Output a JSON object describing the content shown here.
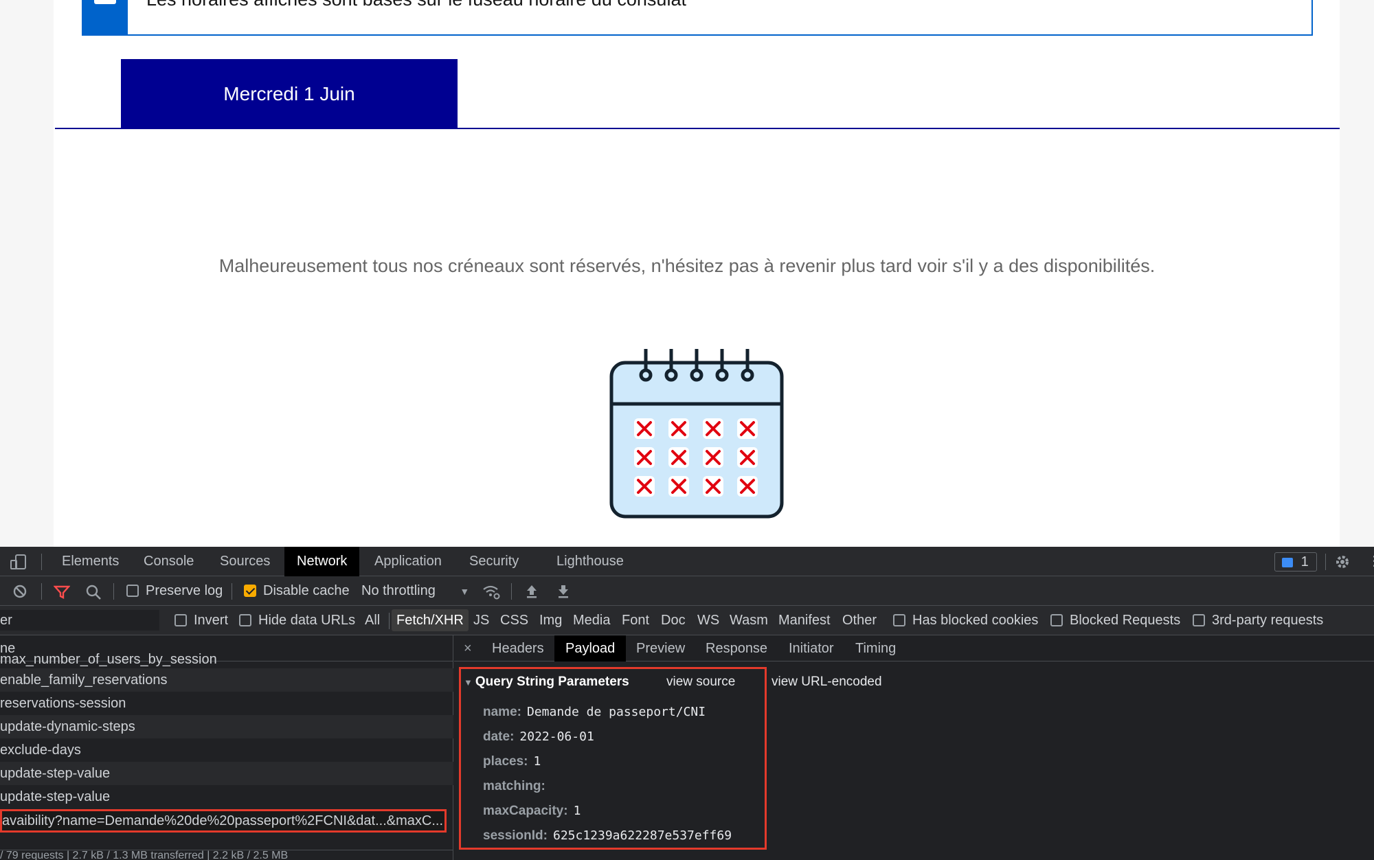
{
  "page": {
    "info_text": "Les horaires affichés sont basés sur le fuseau horaire du consulat",
    "day_tab": "Mercredi 1 Juin",
    "empty_message": "Malheureusement tous nos créneaux sont réservés, n'hésitez pas à revenir plus tard voir s'il y a des disponibilités."
  },
  "devtools": {
    "tabs": [
      "Elements",
      "Console",
      "Sources",
      "Network",
      "Application",
      "Security",
      "Lighthouse"
    ],
    "active_tab": "Network",
    "issues_count": "1",
    "toolbar": {
      "preserve_log": "Preserve log",
      "disable_cache": "Disable cache",
      "throttling": "No throttling"
    },
    "filter": {
      "input_fragment": "er",
      "invert": "Invert",
      "hide_data_urls": "Hide data URLs",
      "types": [
        "All",
        "Fetch/XHR",
        "JS",
        "CSS",
        "Img",
        "Media",
        "Font",
        "Doc",
        "WS",
        "Wasm",
        "Manifest",
        "Other"
      ],
      "active_type": "Fetch/XHR",
      "has_blocked_cookies": "Has blocked cookies",
      "blocked_requests": "Blocked Requests",
      "third_party": "3rd-party requests"
    },
    "requests": {
      "column_header": "ne",
      "rows": [
        "max_number_of_users_by_session",
        "enable_family_reservations",
        "reservations-session",
        "update-dynamic-steps",
        "exclude-days",
        "update-step-value",
        "update-step-value"
      ],
      "selected": "avaibility?name=Demande%20de%20passeport%2FCNI&dat...&maxC...",
      "footer": "/ 79 requests  |  2.7 kB / 1.3 MB transferred  |  2.2 kB / 2.5 MB"
    },
    "detail_tabs": [
      "Headers",
      "Payload",
      "Preview",
      "Response",
      "Initiator",
      "Timing"
    ],
    "active_detail_tab": "Payload",
    "payload": {
      "section_title": "Query String Parameters",
      "view_source": "view source",
      "view_url_encoded": "view URL-encoded",
      "params": [
        {
          "key": "name:",
          "value": "Demande de passeport/CNI"
        },
        {
          "key": "date:",
          "value": "2022-06-01"
        },
        {
          "key": "places:",
          "value": "1"
        },
        {
          "key": "matching:",
          "value": ""
        },
        {
          "key": "maxCapacity:",
          "value": "1"
        },
        {
          "key": "sessionId:",
          "value": "625c1239a622287e537eff69"
        }
      ]
    }
  }
}
